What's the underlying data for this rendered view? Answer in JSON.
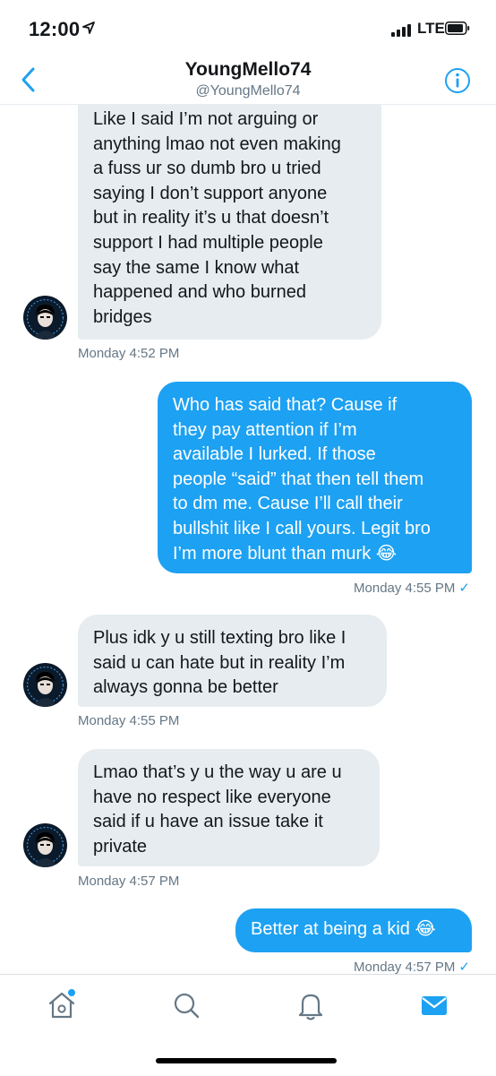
{
  "status_bar": {
    "time": "12:00",
    "network": "LTE",
    "icons": [
      "location-arrow-icon",
      "signal-bars-icon",
      "battery-icon"
    ]
  },
  "header": {
    "name": "YoungMello74",
    "handle": "@YoungMello74",
    "icons": [
      "back-chevron-icon",
      "info-icon"
    ]
  },
  "messages": [
    {
      "direction": "received",
      "text": "Like I said I’m not arguing or\nanything lmao not even making\na fuss ur so dumb bro u tried\nsaying I don’t support anyone\nbut in reality it’s u that doesn’t\nsupport I had multiple people\nsay the same I know what\nhappened and who burned\nbridges",
      "timestamp": "Monday 4:52 PM"
    },
    {
      "direction": "sent",
      "text": "Who has said that? Cause if\nthey pay attention if I’m\navailable I lurked. If those\npeople “said” that then tell them\nto dm me. Cause I’ll call their\nbullshit like I call yours. Legit bro\nI’m more blunt than murk 😂",
      "timestamp": "Monday 4:55 PM",
      "status_glyph": "✓"
    },
    {
      "direction": "received",
      "text": "Plus idk y u still texting bro like I\nsaid u can hate but in reality I’m\nalways gonna be better",
      "timestamp": "Monday 4:55 PM"
    },
    {
      "direction": "received",
      "text": "Lmao that’s y u the way u are u\nhave no respect like everyone\nsaid if u have an issue take it\nprivate",
      "timestamp": "Monday 4:57 PM"
    },
    {
      "direction": "sent",
      "text": "Better at being a kid 😂",
      "timestamp": "Monday 4:57 PM",
      "status_glyph": "✓"
    }
  ],
  "tab_bar": {
    "tabs": [
      {
        "name": "home",
        "icon": "home-icon",
        "active": false,
        "has_notification": true
      },
      {
        "name": "search",
        "icon": "search-icon",
        "active": false
      },
      {
        "name": "notifications",
        "icon": "bell-icon",
        "active": false
      },
      {
        "name": "messages",
        "icon": "mail-icon",
        "active": true
      }
    ]
  },
  "colors": {
    "accent": "#1da1f2",
    "received_bubble": "#e6ecf0",
    "sent_bubble": "#1da1f2",
    "secondary_text": "#657786",
    "primary_text": "#14171a"
  }
}
